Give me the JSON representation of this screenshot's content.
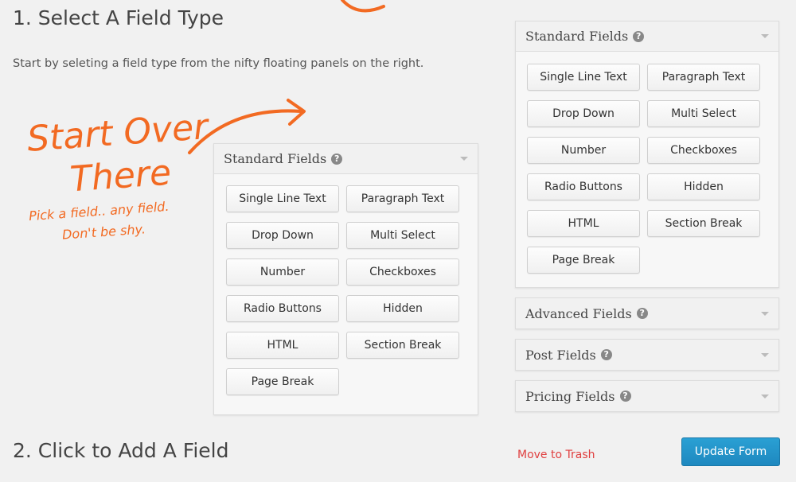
{
  "heading1": "1. Select A Field Type",
  "intro": "Start by seleting a field type from the nifty floating panels on the right.",
  "annotation": {
    "line1": "Start Over",
    "line2": "There",
    "line3": "Pick a field.. any field.",
    "line4": "Don't be shy."
  },
  "field_buttons": [
    "Single Line Text",
    "Paragraph Text",
    "Drop Down",
    "Multi Select",
    "Number",
    "Checkboxes",
    "Radio Buttons",
    "Hidden",
    "HTML",
    "Section Break",
    "Page Break"
  ],
  "center_panel": {
    "title": "Standard Fields",
    "help": "?"
  },
  "right_panel": {
    "standard_title": "Standard Fields",
    "advanced_title": "Advanced Fields",
    "post_title": "Post Fields",
    "pricing_title": "Pricing Fields",
    "help": "?"
  },
  "heading2": "2. Click to Add A Field",
  "trash_label": "Move to Trash",
  "update_label": "Update Form",
  "colors": {
    "accent": "#f26a22",
    "primary_button": "#2196c9",
    "trash": "#e04040"
  },
  "icons": {
    "help": "question-circle-icon",
    "collapse": "caret-down-icon",
    "arrow": "curved-arrow-icon"
  }
}
